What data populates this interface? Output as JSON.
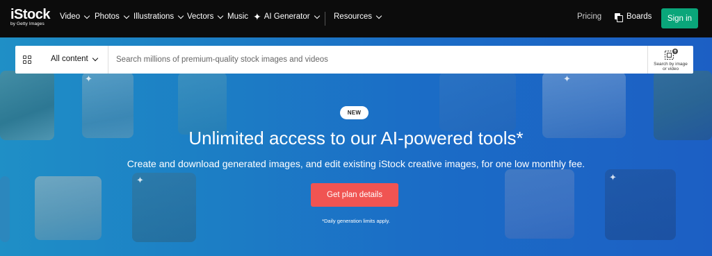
{
  "nav": {
    "logo": {
      "main": "iStock",
      "sub": "by Getty Images"
    },
    "items": [
      {
        "label": "Video"
      },
      {
        "label": "Photos"
      },
      {
        "label": "Illustrations"
      },
      {
        "label": "Vectors"
      },
      {
        "label": "Music"
      },
      {
        "label": "AI Generator"
      },
      {
        "label": "Resources"
      }
    ],
    "pricing": "Pricing",
    "boards": "Boards",
    "signin": "Sign in"
  },
  "search": {
    "scope": "All content",
    "placeholder": "Search millions of premium-quality stock images and videos",
    "image_search_label_1": "Search by image",
    "image_search_label_2": "or video"
  },
  "hero": {
    "badge": "NEW",
    "headline": "Unlimited access to our AI-powered tools*",
    "subline": "Create and download generated images, and edit existing iStock creative images, for one low monthly fee.",
    "cta": "Get plan details",
    "footnote": "*Daily generation limits apply."
  },
  "colors": {
    "nav_bg": "#0c0c0c",
    "signin_bg": "#0aa67a",
    "cta_bg": "#f05452",
    "hero_bg": "#1c7ec5"
  }
}
